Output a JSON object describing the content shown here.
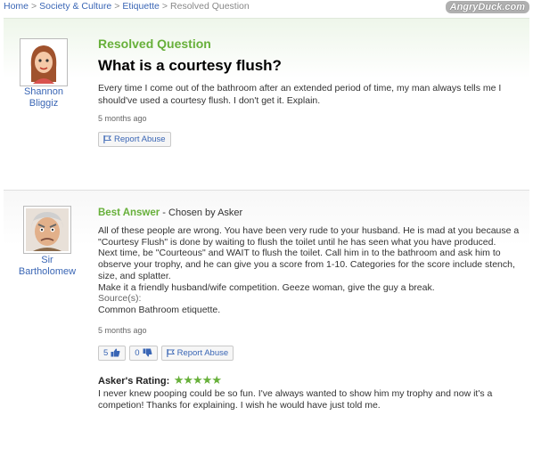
{
  "breadcrumb": [
    "Home",
    "Society & Culture",
    "Etiquette",
    "Resolved Question"
  ],
  "watermark": "AngryDuck.com",
  "question": {
    "status": "Resolved Question",
    "title": "What is a courtesy flush?",
    "body": "Every time I come out of the bathroom after an extended period of time, my man always tells me I should've used a courtesy flush. I don't get it. Explain.",
    "asker_first": "Shannon",
    "asker_last": "Bliggiz",
    "time": "5 months ago",
    "report_label": "Report Abuse"
  },
  "answer": {
    "best_label": "Best Answer",
    "chosen_by": " - Chosen by Asker",
    "user_first": "Sir",
    "user_last": "Bartholomew",
    "paragraphs": [
      "All of these people are wrong. You have been very rude to your husband. He is mad at you because a \"Courtesy Flush\" is done by waiting to flush the toilet until he has seen what you have produced.",
      "Next time, be \"Courteous\" and WAIT to flush the toilet. Call him in to the bathroom and ask him to observe your trophy, and he can give you a score from 1-10. Categories for the score include stench, size, and splatter.",
      "Make it a friendly husband/wife competition. Geeze woman, give the guy a break."
    ],
    "sources_label": "Source(s):",
    "source": "Common Bathroom etiquette.",
    "time": "5 months ago",
    "thumbs_up": "5",
    "thumbs_down": "0",
    "report_label": "Report Abuse",
    "rating_label": "Asker's Rating:",
    "stars": "★★★★★",
    "rating_comment": "I never knew pooping could be so fun. I've always wanted to show him my trophy and now it's a competion! Thanks for explaining. I wish he would have just told me."
  },
  "colors": {
    "link": "#3a66b5",
    "accent_green": "#67b03a"
  }
}
